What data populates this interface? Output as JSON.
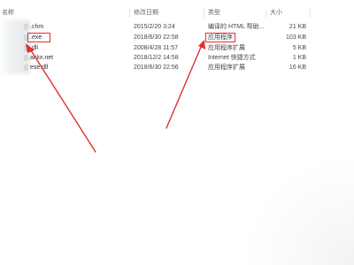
{
  "columns": {
    "name": "名称",
    "date": "修改日期",
    "type": "类型",
    "size": "大小"
  },
  "rows": [
    {
      "name": ".chm",
      "date": "2015/2/20 3:24",
      "type": "编译的 HTML 帮助...",
      "size": "21 KB"
    },
    {
      "name": ".exe",
      "date": "2018/6/30 22:58",
      "type": "应用程序",
      "size": "103 KB"
    },
    {
      "name": ".dll",
      "date": "2008/4/28 11:57",
      "type": "应用程序扩展",
      "size": "5 KB"
    },
    {
      "name": "akkx.net",
      "date": "2018/12/2 14:58",
      "type": "Internet 快捷方式",
      "size": "1 KB"
    },
    {
      "name": "ese.dll",
      "date": "2018/6/30 22:56",
      "type": "应用程序扩展",
      "size": "16 KB"
    }
  ],
  "annotation_color": "#e03030"
}
